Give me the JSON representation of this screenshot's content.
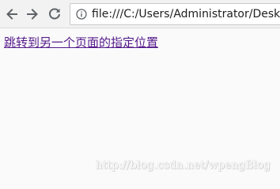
{
  "browser": {
    "url": "file:///C:/Users/Administrator/Desktop/",
    "icons": {
      "back": "back-arrow-icon",
      "forward": "forward-arrow-icon",
      "reload": "reload-icon",
      "info": "info-icon"
    }
  },
  "page": {
    "link_text": "跳转到另一个页面的指定位置"
  },
  "watermark": "http://blog.csdn.net/wpengBlog",
  "colors": {
    "link_visited": "#551a8b",
    "toolbar_bg": "#f2f2f2",
    "page_bg": "#fafafa",
    "icon_gray": "#5f6368"
  }
}
